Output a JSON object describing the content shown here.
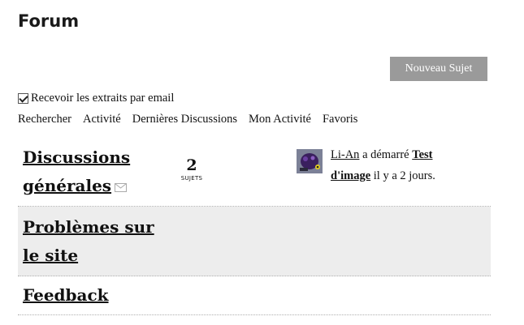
{
  "header": {
    "title": "Forum"
  },
  "toolbar": {
    "new_topic_label": "Nouveau Sujet"
  },
  "email_option": {
    "label": "Recevoir les extraits par email",
    "checked": true
  },
  "tabs": [
    {
      "label": "Rechercher"
    },
    {
      "label": "Activité"
    },
    {
      "label": "Dernières Discussions"
    },
    {
      "label": "Mon Activité"
    },
    {
      "label": "Favoris"
    }
  ],
  "categories": [
    {
      "title_line1": "Discussions",
      "title_line2": "générales",
      "topic_count": "2",
      "topic_count_label": "SUJETS",
      "latest": {
        "user": "Li-An",
        "action": "a démarré",
        "topic_line1": "Test",
        "topic_line2": "d'image",
        "time": "il y a 2 jours."
      }
    },
    {
      "title_line1": "Problèmes sur",
      "title_line2": "le site"
    },
    {
      "title_line1": "Feedback"
    }
  ]
}
